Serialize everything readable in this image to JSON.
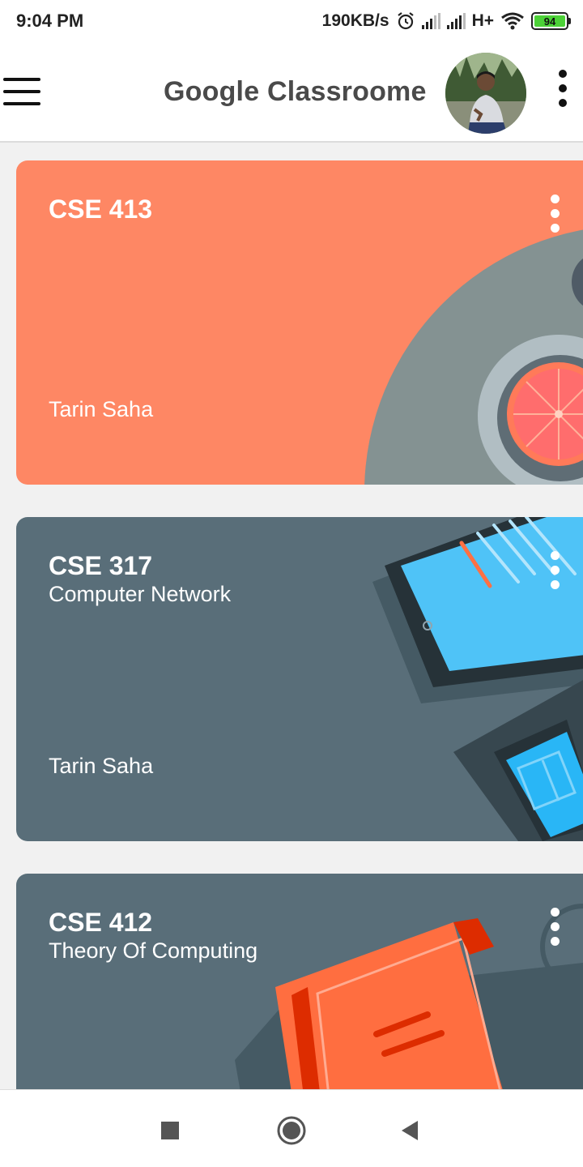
{
  "status_bar": {
    "time": "9:04 PM",
    "network_speed": "190KB/s",
    "network_type": "H+",
    "battery_level": "94",
    "icons": [
      "alarm-icon",
      "signal-icon",
      "signal-icon",
      "wifi-icon",
      "battery-icon"
    ]
  },
  "app_bar": {
    "title": "Google Classroome",
    "menu_icon": "hamburger-menu-icon",
    "overflow_icon": "more-vert-icon",
    "avatar": "profile-avatar"
  },
  "classes": [
    {
      "code": "CSE 413",
      "name": "",
      "teacher": "Tarin Saha",
      "color": "#fe8764",
      "theme": "grapefruit-plate"
    },
    {
      "code": "CSE 317",
      "name": "Computer Network",
      "teacher": "Tarin Saha",
      "color": "#596e79",
      "theme": "tablets"
    },
    {
      "code": "CSE 412",
      "name": "Theory Of Computing",
      "teacher": "",
      "color": "#596e79",
      "theme": "book"
    }
  ],
  "nav_bar": {
    "icons": [
      "recents-square-icon",
      "home-circle-icon",
      "back-triangle-icon"
    ]
  }
}
